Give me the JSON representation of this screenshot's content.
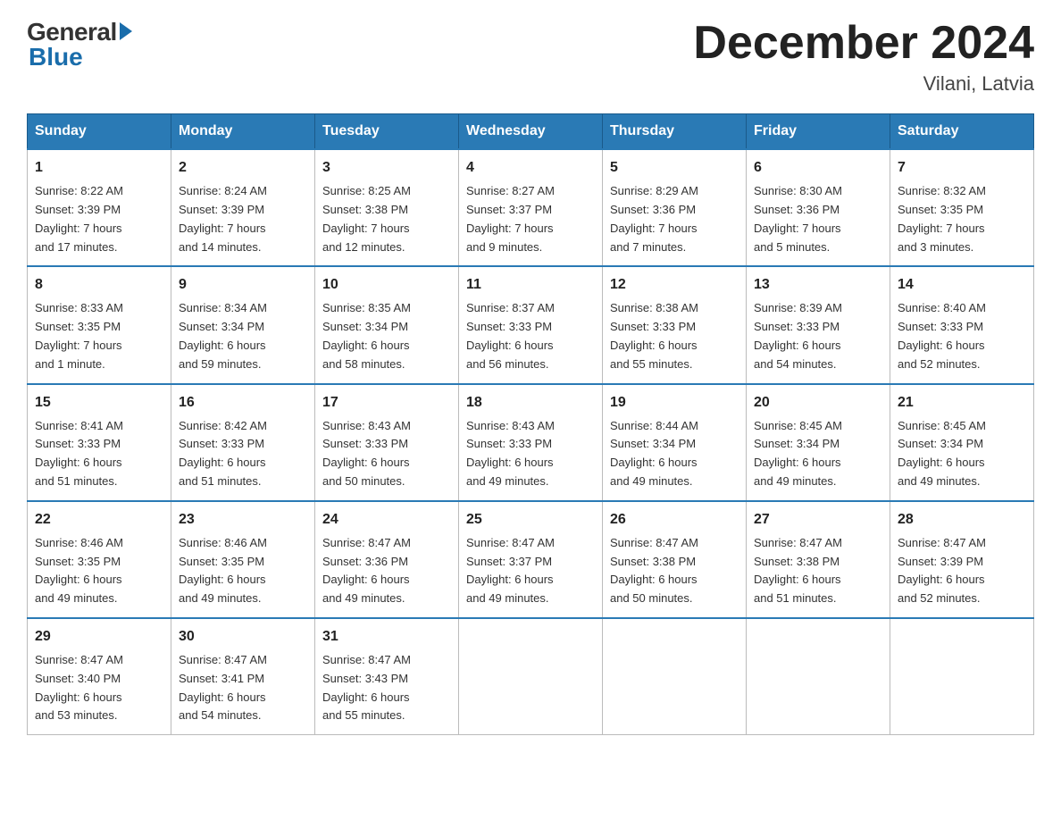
{
  "header": {
    "logo_general": "General",
    "logo_blue": "Blue",
    "month_title": "December 2024",
    "location": "Vilani, Latvia"
  },
  "days_of_week": [
    "Sunday",
    "Monday",
    "Tuesday",
    "Wednesday",
    "Thursday",
    "Friday",
    "Saturday"
  ],
  "weeks": [
    [
      {
        "day": "1",
        "sunrise": "8:22 AM",
        "sunset": "3:39 PM",
        "daylight": "7 hours and 17 minutes."
      },
      {
        "day": "2",
        "sunrise": "8:24 AM",
        "sunset": "3:39 PM",
        "daylight": "7 hours and 14 minutes."
      },
      {
        "day": "3",
        "sunrise": "8:25 AM",
        "sunset": "3:38 PM",
        "daylight": "7 hours and 12 minutes."
      },
      {
        "day": "4",
        "sunrise": "8:27 AM",
        "sunset": "3:37 PM",
        "daylight": "7 hours and 9 minutes."
      },
      {
        "day": "5",
        "sunrise": "8:29 AM",
        "sunset": "3:36 PM",
        "daylight": "7 hours and 7 minutes."
      },
      {
        "day": "6",
        "sunrise": "8:30 AM",
        "sunset": "3:36 PM",
        "daylight": "7 hours and 5 minutes."
      },
      {
        "day": "7",
        "sunrise": "8:32 AM",
        "sunset": "3:35 PM",
        "daylight": "7 hours and 3 minutes."
      }
    ],
    [
      {
        "day": "8",
        "sunrise": "8:33 AM",
        "sunset": "3:35 PM",
        "daylight": "7 hours and 1 minute."
      },
      {
        "day": "9",
        "sunrise": "8:34 AM",
        "sunset": "3:34 PM",
        "daylight": "6 hours and 59 minutes."
      },
      {
        "day": "10",
        "sunrise": "8:35 AM",
        "sunset": "3:34 PM",
        "daylight": "6 hours and 58 minutes."
      },
      {
        "day": "11",
        "sunrise": "8:37 AM",
        "sunset": "3:33 PM",
        "daylight": "6 hours and 56 minutes."
      },
      {
        "day": "12",
        "sunrise": "8:38 AM",
        "sunset": "3:33 PM",
        "daylight": "6 hours and 55 minutes."
      },
      {
        "day": "13",
        "sunrise": "8:39 AM",
        "sunset": "3:33 PM",
        "daylight": "6 hours and 54 minutes."
      },
      {
        "day": "14",
        "sunrise": "8:40 AM",
        "sunset": "3:33 PM",
        "daylight": "6 hours and 52 minutes."
      }
    ],
    [
      {
        "day": "15",
        "sunrise": "8:41 AM",
        "sunset": "3:33 PM",
        "daylight": "6 hours and 51 minutes."
      },
      {
        "day": "16",
        "sunrise": "8:42 AM",
        "sunset": "3:33 PM",
        "daylight": "6 hours and 51 minutes."
      },
      {
        "day": "17",
        "sunrise": "8:43 AM",
        "sunset": "3:33 PM",
        "daylight": "6 hours and 50 minutes."
      },
      {
        "day": "18",
        "sunrise": "8:43 AM",
        "sunset": "3:33 PM",
        "daylight": "6 hours and 49 minutes."
      },
      {
        "day": "19",
        "sunrise": "8:44 AM",
        "sunset": "3:34 PM",
        "daylight": "6 hours and 49 minutes."
      },
      {
        "day": "20",
        "sunrise": "8:45 AM",
        "sunset": "3:34 PM",
        "daylight": "6 hours and 49 minutes."
      },
      {
        "day": "21",
        "sunrise": "8:45 AM",
        "sunset": "3:34 PM",
        "daylight": "6 hours and 49 minutes."
      }
    ],
    [
      {
        "day": "22",
        "sunrise": "8:46 AM",
        "sunset": "3:35 PM",
        "daylight": "6 hours and 49 minutes."
      },
      {
        "day": "23",
        "sunrise": "8:46 AM",
        "sunset": "3:35 PM",
        "daylight": "6 hours and 49 minutes."
      },
      {
        "day": "24",
        "sunrise": "8:47 AM",
        "sunset": "3:36 PM",
        "daylight": "6 hours and 49 minutes."
      },
      {
        "day": "25",
        "sunrise": "8:47 AM",
        "sunset": "3:37 PM",
        "daylight": "6 hours and 49 minutes."
      },
      {
        "day": "26",
        "sunrise": "8:47 AM",
        "sunset": "3:38 PM",
        "daylight": "6 hours and 50 minutes."
      },
      {
        "day": "27",
        "sunrise": "8:47 AM",
        "sunset": "3:38 PM",
        "daylight": "6 hours and 51 minutes."
      },
      {
        "day": "28",
        "sunrise": "8:47 AM",
        "sunset": "3:39 PM",
        "daylight": "6 hours and 52 minutes."
      }
    ],
    [
      {
        "day": "29",
        "sunrise": "8:47 AM",
        "sunset": "3:40 PM",
        "daylight": "6 hours and 53 minutes."
      },
      {
        "day": "30",
        "sunrise": "8:47 AM",
        "sunset": "3:41 PM",
        "daylight": "6 hours and 54 minutes."
      },
      {
        "day": "31",
        "sunrise": "8:47 AM",
        "sunset": "3:43 PM",
        "daylight": "6 hours and 55 minutes."
      },
      null,
      null,
      null,
      null
    ]
  ],
  "labels": {
    "sunrise": "Sunrise:",
    "sunset": "Sunset:",
    "daylight": "Daylight:"
  }
}
